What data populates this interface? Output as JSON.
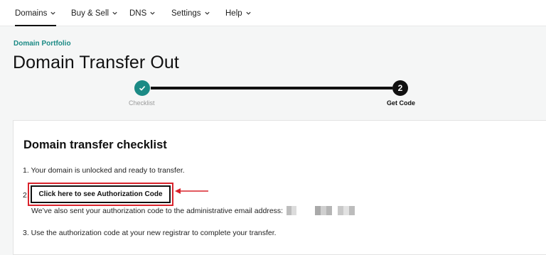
{
  "nav": {
    "items": [
      {
        "label": "Domains",
        "active": true
      },
      {
        "label": "Buy & Sell",
        "active": false
      },
      {
        "label": "DNS",
        "active": false
      },
      {
        "label": "Settings",
        "active": false
      },
      {
        "label": "Help",
        "active": false
      }
    ]
  },
  "breadcrumb": "Domain Portfolio",
  "page_title": "Domain Transfer Out",
  "stepper": {
    "steps": [
      {
        "label": "Checklist",
        "state": "complete",
        "icon": "check-icon"
      },
      {
        "label": "Get Code",
        "state": "current",
        "number": "2"
      }
    ]
  },
  "checklist": {
    "title": "Domain transfer checklist",
    "item1": "1. Your domain is unlocked and ready to transfer.",
    "item2_number": "2.",
    "auth_button_label": "Click here to see Authorization Code",
    "email_note": "We’ve also sent your authorization code to the administrative email address:",
    "item3": "3. Use the authorization code at your new registrar to complete your transfer."
  },
  "colors": {
    "accent_teal": "#1b8a85",
    "annotation_red": "#d9232c",
    "text_dark": "#111111",
    "background": "#f5f6f6"
  }
}
